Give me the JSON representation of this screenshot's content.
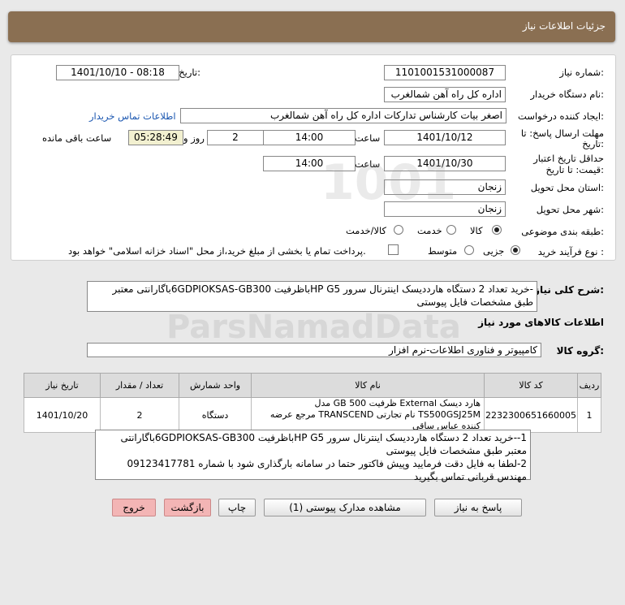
{
  "header": {
    "title": "جزئیات اطلاعات نیاز"
  },
  "form": {
    "need_number_label": "شماره نیاز:",
    "need_number": "1101001531000087",
    "announce_label": "تاریخ و ساعت اعلان عمومی:",
    "announce_value": "1401/10/10 - 08:18",
    "buyer_label": "نام دستگاه خریدار:",
    "buyer_value": "اداره کل راه آهن شمالغرب",
    "requester_label": "ایجاد کننده درخواست:",
    "requester_value": "اصغر بیات کارشناس تدارکات اداره کل راه آهن شمالغرب",
    "contact_link": "اطلاعات تماس خریدار",
    "deadline_label_1": "مهلت ارسال پاسخ: تا",
    "deadline_label_2": "تاریخ:",
    "deadline_date": "1401/10/12",
    "time_label": "ساعت",
    "deadline_time": "14:00",
    "days_value": "2",
    "days_label": "روز و",
    "remaining_value": "05:28:49",
    "remaining_label": "ساعت باقی مانده",
    "validity_label_1": "حداقل تاریخ اعتبار",
    "validity_label_2": "قیمت: تا تاریخ:",
    "validity_date": "1401/10/30",
    "validity_time_label": "ساعت",
    "validity_time": "14:00",
    "province_label": "استان محل تحویل:",
    "province_value": "زنجان",
    "city_label": "شهر محل تحویل:",
    "city_value": "زنجان",
    "category_label": "طبقه بندی موضوعی:",
    "category_options": [
      "کالا",
      "خدمت",
      "کالا/خدمت"
    ],
    "purchase_label": "نوع فرآیند خرید :",
    "purchase_options": [
      "جزیی",
      "متوسط"
    ],
    "treasury_note": "پرداخت تمام یا بخشی از مبلغ خرید،از محل \"اسناد خزانه اسلامی\" خواهد بود."
  },
  "summary": {
    "label": "شرح کلی نیاز:",
    "text": "-خرید تعداد 2 دستگاه هارددیسک اینترنال سرور HP G5باظرفیت  6GDPIOKSAS-GB300باگارانتی معتبر طبق مشخصات فایل پیوستی"
  },
  "goods": {
    "section_title": "اطلاعات کالاهای مورد نیاز",
    "group_label": "گروه کالا:",
    "group_value": "کامپیوتر و فناوری اطلاعات-نرم افزار",
    "columns": [
      "ردیف",
      "کد کالا",
      "نام کالا",
      "واحد شمارش",
      "تعداد / مقدار",
      "تاریخ نیاز"
    ],
    "rows": [
      {
        "row": "1",
        "code": "2232300651660005",
        "name": "هارد دیسک External ظرفیت 500 GB مدل TS500GSJ25M نام تجارتی TRANSCEND مرجع عرضه کننده عباس ساقی",
        "unit": "دستگاه",
        "qty": "2",
        "date": "1401/10/20"
      }
    ]
  },
  "notes": {
    "line1": "1--خرید تعداد 2 دستگاه هارددیسک اینترنال سرور HP G5باظرفیت  6GDPIOKSAS-GB300باگارانتی معتبر طبق مشخصات فایل پیوستی",
    "line2": "2-لطفا به فایل دقت فرمایید وپیش فاکتور حتما در سامانه بارگذاری شود با شماره 09123417781 مهندس قربانی تماس بگیرید"
  },
  "buttons": {
    "reply": "پاسخ به نیاز",
    "attachments": "مشاهده مدارک پیوستی (1)",
    "print": "چاپ",
    "back": "بازگشت",
    "exit": "خروج"
  },
  "watermark": {
    "brand": "ParsNamadData"
  }
}
